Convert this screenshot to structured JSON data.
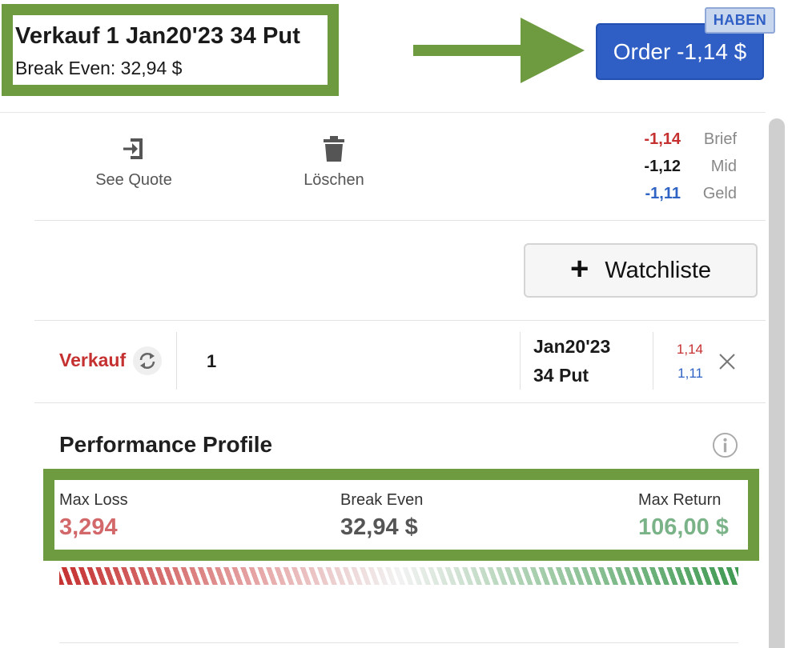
{
  "header": {
    "order_title": "Verkauf 1 Jan20'23 34 Put",
    "break_even_text": "Break Even: 32,94 $",
    "order_button_label": "Order -1,14 $",
    "badge_label": "HABEN",
    "accent_color": "#6f9b40",
    "button_color": "#2f5fc4"
  },
  "actions": {
    "see_quote_label": "See Quote",
    "delete_label": "Löschen",
    "see_quote_icon": "enter-arrow-icon",
    "delete_icon": "trash-icon"
  },
  "quote": {
    "ask_value": "-1,14",
    "ask_label": "Brief",
    "mid_value": "-1,12",
    "mid_label": "Mid",
    "bid_value": "-1,11",
    "bid_label": "Geld"
  },
  "watchlist": {
    "plus": "+",
    "label": "Watchliste"
  },
  "leg": {
    "action": "Verkauf",
    "quantity": "1",
    "expiration": "Jan20'23",
    "strike": "34 Put",
    "ask": "1,14",
    "bid": "1,11"
  },
  "performance": {
    "title": "Performance Profile",
    "max_loss_label": "Max Loss",
    "max_loss_value": "3,294",
    "break_even_label": "Break Even",
    "break_even_value": "32,94 $",
    "max_return_label": "Max Return",
    "max_return_value": "106,00 $",
    "loss_color": "#d2686a",
    "return_color": "#7bb388"
  }
}
